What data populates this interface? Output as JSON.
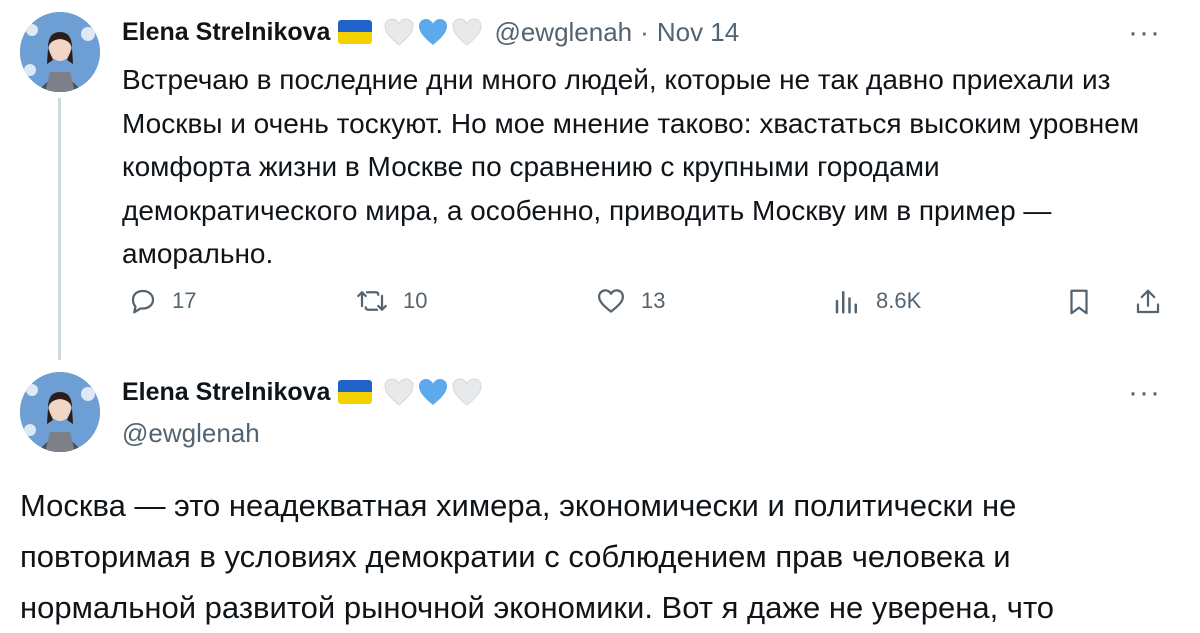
{
  "tweet1": {
    "author_name": "Elena Strelnikova",
    "handle": "@ewglenah",
    "separator": "·",
    "date": "Nov 14",
    "more": "···",
    "text": "Встречаю в последние дни много людей, которые не так давно приехали из Москвы и очень тоскуют. Но мое мнение таково: хвастаться высоким уровнем комфорта жизни в Москве по сравнению с крупными городами демократического мира, а особенно, приводить Москву им в пример — аморально.",
    "stats": {
      "replies": "17",
      "reposts": "10",
      "likes": "13",
      "views": "8.6K"
    }
  },
  "tweet2": {
    "author_name": "Elena Strelnikova",
    "handle": "@ewglenah",
    "more": "···",
    "text": "Москва — это неадекватная химера, экономически и политически не повторимая в условиях демократии с соблюдением прав человека и нормальной развитой рыночной экономики. Вот я даже не уверена, что"
  },
  "icons": {
    "flag": "ukraine-flag-icon",
    "hearts": [
      "white-heart-icon",
      "blue-heart-icon",
      "white-heart-icon"
    ],
    "reply": "reply-icon",
    "repost": "repost-icon",
    "like": "like-icon",
    "views": "views-icon",
    "bookmark": "bookmark-icon",
    "share": "share-icon"
  },
  "colors": {
    "text": "#0f1419",
    "secondary": "#536471",
    "thread_line": "#cfd9de",
    "flag_blue": "#1f62c9",
    "flag_yellow": "#f5d000",
    "heart_blue": "#5ea8ec",
    "heart_white": "#e7e9ea"
  }
}
